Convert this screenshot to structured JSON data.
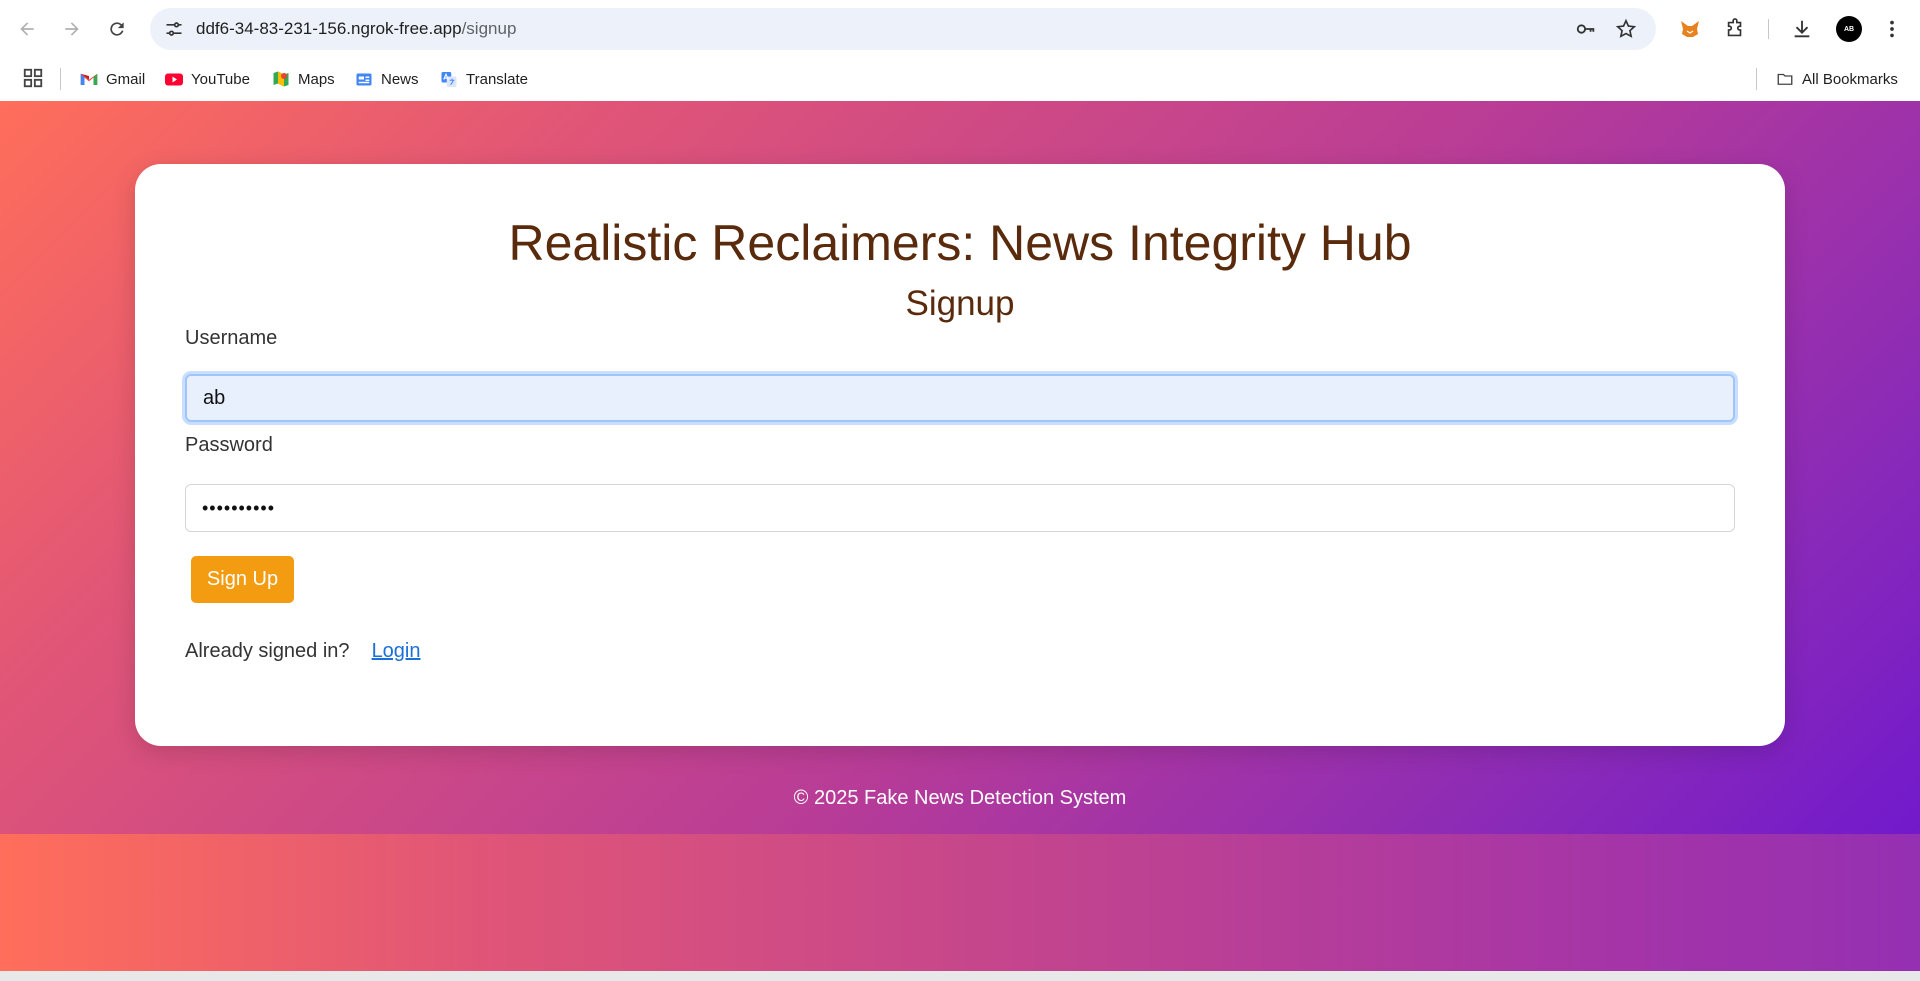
{
  "browser": {
    "url_host": "ddf6-34-83-231-156.ngrok-free.app",
    "url_path": "/signup",
    "avatar_initials": "AB",
    "bookmarks": [
      {
        "label": "Gmail",
        "icon": "gmail-icon"
      },
      {
        "label": "YouTube",
        "icon": "youtube-icon"
      },
      {
        "label": "Maps",
        "icon": "maps-icon"
      },
      {
        "label": "News",
        "icon": "news-icon"
      },
      {
        "label": "Translate",
        "icon": "translate-icon"
      }
    ],
    "all_bookmarks_label": "All Bookmarks"
  },
  "page": {
    "title": "Realistic Reclaimers: News Integrity Hub",
    "subtitle": "Signup",
    "username_label": "Username",
    "username_value": "ab",
    "password_label": "Password",
    "password_value": "••••••••••",
    "signup_button": "Sign Up",
    "already_text": "Already signed in?",
    "login_link": "Login",
    "footer": "© 2025 Fake News Detection System"
  },
  "colors": {
    "button": "#f39c12",
    "heading": "#5a2a0c",
    "link": "#1a6fd9",
    "gradient_start": "#ff6e5a",
    "gradient_end": "#6a14d2"
  }
}
